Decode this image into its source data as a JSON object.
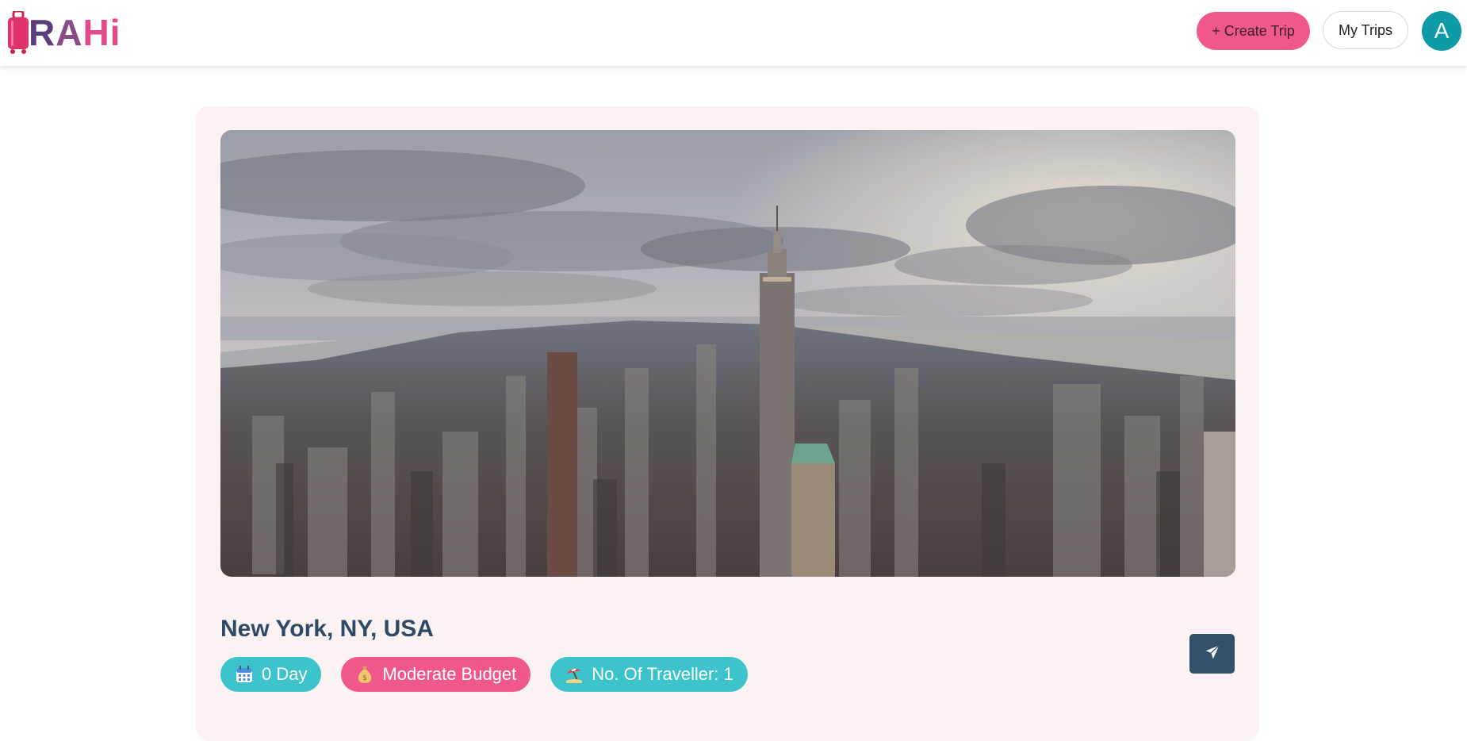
{
  "header": {
    "logo_text_parts": [
      "R",
      "A",
      "Hi"
    ],
    "create_trip_label": "+ Create Trip",
    "my_trips_label": "My Trips",
    "avatar_initial": "A"
  },
  "trip": {
    "location": "New York, NY, USA",
    "chips": [
      {
        "label": "0 Day",
        "icon": "calendar-icon"
      },
      {
        "label": "Moderate Budget",
        "icon": "money-bag-icon"
      },
      {
        "label": "No. Of Traveller: 1",
        "icon": "beach-icon"
      }
    ],
    "share_icon": "send-icon"
  },
  "colors": {
    "brand_pink": "#f0578b",
    "teal": "#3dc3cc",
    "avatar_teal": "#0e9aa7",
    "heading_navy": "#2f4a66",
    "share_button": "#33506b",
    "card_bg": "#fbf3f3"
  }
}
